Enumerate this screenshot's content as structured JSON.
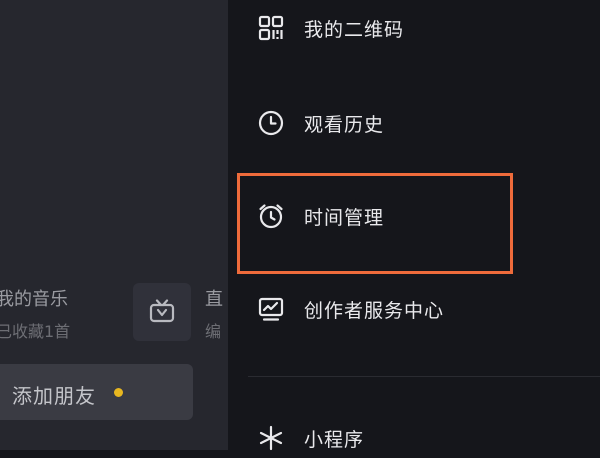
{
  "left_panel": {
    "music_title": "我的音乐",
    "music_sub": "已收藏1首",
    "clipped_title": "直",
    "clipped_sub": "编",
    "add_friend_label": "添加朋友"
  },
  "menu": {
    "items": [
      {
        "label": "我的二维码",
        "icon": "qr-code-icon"
      },
      {
        "label": "观看历史",
        "icon": "clock-icon"
      },
      {
        "label": "时间管理",
        "icon": "alarm-clock-icon"
      },
      {
        "label": "创作者服务中心",
        "icon": "creator-chart-icon"
      },
      {
        "label": "小程序",
        "icon": "mini-program-icon"
      }
    ]
  },
  "colors": {
    "highlight": "#ee6b3b",
    "badge_dot": "#e8b720"
  }
}
